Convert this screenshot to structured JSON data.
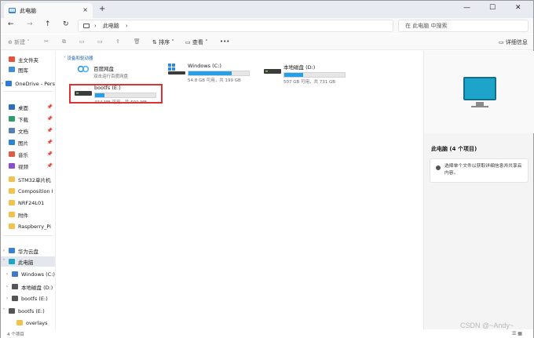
{
  "tab": {
    "title": "此电脑",
    "close": "×",
    "new": "+"
  },
  "window_controls": {
    "minimize": "—",
    "maximize": "☐",
    "close": "✕"
  },
  "nav": {
    "back": "←",
    "forward": "→",
    "up": "↑",
    "refresh": "↻"
  },
  "address": {
    "sep1": "›",
    "location": "此电脑",
    "sep2": "›"
  },
  "search": {
    "placeholder": "在 此电脑 中搜索"
  },
  "commandbar": {
    "new_label": "⊕ 新建 ˅",
    "cut": "✂",
    "copy": "⧉",
    "paste": "▭",
    "rename": "▭",
    "share": "⇪",
    "delete": "🗑",
    "sort_label": "⇅ 排序 ˅",
    "view_label": "▭ 查看 ˅",
    "more": "•••",
    "details_label": "▭ 详细信息"
  },
  "sidebar": {
    "items": [
      {
        "label": "主文件夹",
        "chevron": "",
        "icon_color": "#e5533d"
      },
      {
        "label": "图库",
        "chevron": "",
        "icon_color": "#3f8fd8"
      },
      {
        "label": "OneDrive - Pers",
        "chevron": "›",
        "icon_color": "#2c7bd6"
      },
      {
        "label": "桌面",
        "chevron": "",
        "icon_color": "#2f6dbf",
        "pin": "📌"
      },
      {
        "label": "下载",
        "chevron": "",
        "icon_color": "#2f9d6b",
        "pin": "📌"
      },
      {
        "label": "文档",
        "chevron": "",
        "icon_color": "#5a7fb8",
        "pin": "📌"
      },
      {
        "label": "图片",
        "chevron": "",
        "icon_color": "#2f83d1",
        "pin": "📌"
      },
      {
        "label": "音乐",
        "chevron": "",
        "icon_color": "#e25a41",
        "pin": "📌"
      },
      {
        "label": "视频",
        "chevron": "",
        "icon_color": "#8a4fd1",
        "pin": "📌"
      },
      {
        "label": "STM32单片机",
        "chevron": "",
        "icon_color": "#f3c24c"
      },
      {
        "label": "Composition I",
        "chevron": "",
        "icon_color": "#f3c24c"
      },
      {
        "label": "NRF24L01",
        "chevron": "",
        "icon_color": "#f3c24c"
      },
      {
        "label": "附件",
        "chevron": "",
        "icon_color": "#f3c24c"
      },
      {
        "label": "Raspberry_Pi",
        "chevron": "",
        "icon_color": "#f3c24c"
      },
      {
        "label": "华为云盘",
        "chevron": "›",
        "icon_color": "#3b7fd6"
      },
      {
        "label": "此电脑",
        "chevron": "˅",
        "icon_color": "#1fa4c9",
        "selected": true
      },
      {
        "label": "Windows (C:)",
        "chevron": "›",
        "icon_color": "#3f77c9"
      },
      {
        "label": "本地磁盘 (D:)",
        "chevron": "›",
        "icon_color": "#555555"
      },
      {
        "label": "bootfs (E:)",
        "chevron": "›",
        "icon_color": "#555555"
      },
      {
        "label": "bootfs (E:)",
        "chevron": "˅",
        "icon_color": "#555555"
      },
      {
        "label": "overlays",
        "chevron": "",
        "icon_color": "#f3c24c"
      }
    ]
  },
  "main": {
    "group_header": "˅ 设备和驱动器",
    "drives": [
      {
        "name": "百度网盘",
        "info": "双击运行百度网盘",
        "fill": null,
        "icon": "cloud"
      },
      {
        "name": "Windows (C:)",
        "info": "54.8 GB 可用，共 199 GB",
        "fill": 0.72,
        "icon": "windows-drive"
      },
      {
        "name": "本地磁盘 (D:)",
        "info": "507 GB 可用，共 731 GB",
        "fill": 0.31,
        "icon": "drive"
      },
      {
        "name": "bootfs (E:)",
        "info": "434 MB 可用，共 509 MB",
        "fill": 0.15,
        "icon": "drive"
      }
    ]
  },
  "details": {
    "title": "此电脑 (4 个项目)",
    "message": "选择单个文件以获取详细信息并共享云内容。"
  },
  "status": {
    "count": "4 个项目",
    "view_icons": "☰ ▦"
  },
  "watermark": "CSDN @~Andy~"
}
